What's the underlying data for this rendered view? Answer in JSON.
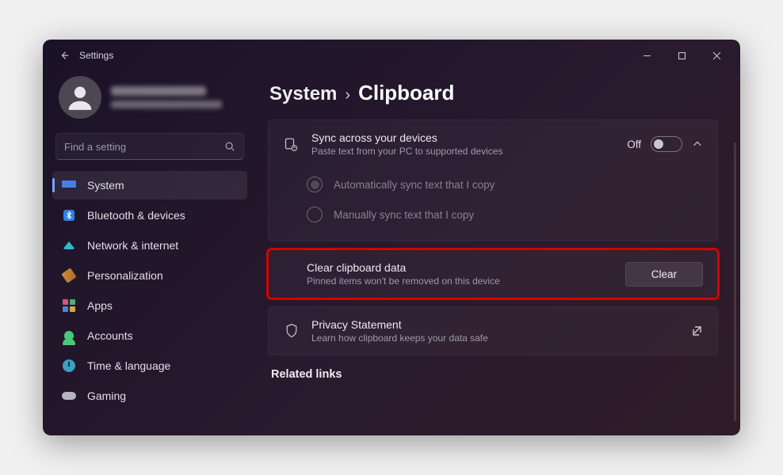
{
  "app": {
    "title": "Settings"
  },
  "search": {
    "placeholder": "Find a setting"
  },
  "sidebar": {
    "items": [
      {
        "label": "System"
      },
      {
        "label": "Bluetooth & devices"
      },
      {
        "label": "Network & internet"
      },
      {
        "label": "Personalization"
      },
      {
        "label": "Apps"
      },
      {
        "label": "Accounts"
      },
      {
        "label": "Time & language"
      },
      {
        "label": "Gaming"
      }
    ]
  },
  "breadcrumb": {
    "parent": "System",
    "sep": "›",
    "current": "Clipboard"
  },
  "sync": {
    "title": "Sync across your devices",
    "subtitle": "Paste text from your PC to supported devices",
    "state": "Off",
    "option_auto": "Automatically sync text that I copy",
    "option_manual": "Manually sync text that I copy"
  },
  "clear": {
    "title": "Clear clipboard data",
    "subtitle": "Pinned items won't be removed on this device",
    "button": "Clear"
  },
  "privacy": {
    "title": "Privacy Statement",
    "subtitle": "Learn how clipboard keeps your data safe"
  },
  "related": {
    "heading": "Related links"
  }
}
